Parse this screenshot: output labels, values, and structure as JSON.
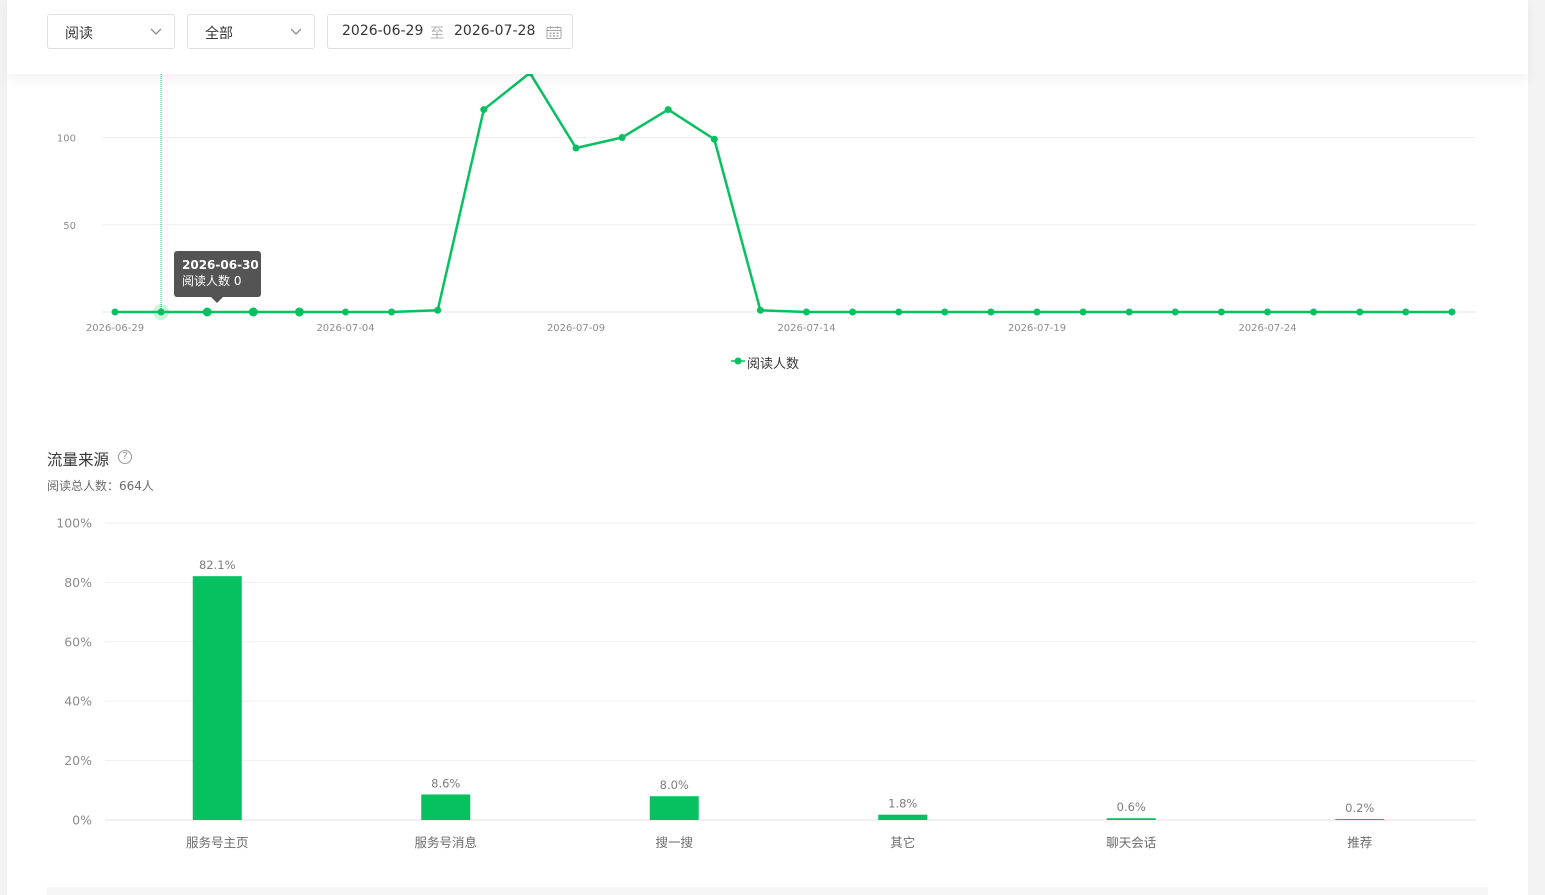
{
  "filters": {
    "metric_select": "阅读",
    "scope_select": "全部",
    "date_start": "2026-06-29",
    "date_separator": "至",
    "date_end": "2026-07-28",
    "calendar_icon": "calendar-icon",
    "dropdown_icon": "chevron-down-icon"
  },
  "trend_chart": {
    "tooltip": {
      "date": "2026-06-30",
      "text": "阅读人数 0"
    },
    "legend": {
      "label": "阅读人数",
      "color": "#07c160"
    }
  },
  "traffic_section": {
    "title": "流量来源",
    "help_icon": "question-circle-icon",
    "total_label": "阅读总人数：",
    "total_value": "664人"
  },
  "chart_data": [
    {
      "type": "line",
      "y_ticks": [
        "50",
        "100"
      ],
      "x_tick_labels": [
        "2026-06-29",
        "2026-07-04",
        "2026-07-09",
        "2026-07-14",
        "2026-07-19",
        "2026-07-24"
      ],
      "x": [
        "2026-06-29",
        "2026-06-30",
        "2026-07-01",
        "2026-07-02",
        "2026-07-03",
        "2026-07-04",
        "2026-07-05",
        "2026-07-06",
        "2026-07-07",
        "2026-07-08",
        "2026-07-09",
        "2026-07-10",
        "2026-07-11",
        "2026-07-12",
        "2026-07-13",
        "2026-07-14",
        "2026-07-15",
        "2026-07-16",
        "2026-07-17",
        "2026-07-18",
        "2026-07-19",
        "2026-07-20",
        "2026-07-21",
        "2026-07-22",
        "2026-07-23",
        "2026-07-24",
        "2026-07-25",
        "2026-07-26",
        "2026-07-27",
        "2026-07-28"
      ],
      "series": [
        {
          "name": "阅读人数",
          "color": "#07c160",
          "values": [
            0,
            0,
            0,
            0,
            0,
            0,
            0,
            1,
            116,
            137,
            94,
            100,
            116,
            99,
            1,
            0,
            0,
            0,
            0,
            0,
            0,
            0,
            0,
            0,
            0,
            0,
            0,
            0,
            0,
            0
          ]
        }
      ],
      "ylim": [
        0,
        137
      ],
      "grid": true,
      "legend_position": "bottom-center"
    },
    {
      "type": "bar",
      "categories": [
        "服务号主页",
        "服务号消息",
        "搜一搜",
        "其它",
        "聊天会话",
        "推荐"
      ],
      "values": [
        82.1,
        8.6,
        8.0,
        1.8,
        0.6,
        0.2
      ],
      "value_labels": [
        "82.1%",
        "8.6%",
        "8.0%",
        "1.8%",
        "0.6%",
        "0.2%"
      ],
      "y_ticks": [
        "0%",
        "20%",
        "40%",
        "60%",
        "80%",
        "100%"
      ],
      "ylim": [
        0,
        100
      ],
      "color": "#07c160",
      "grid": true
    }
  ]
}
